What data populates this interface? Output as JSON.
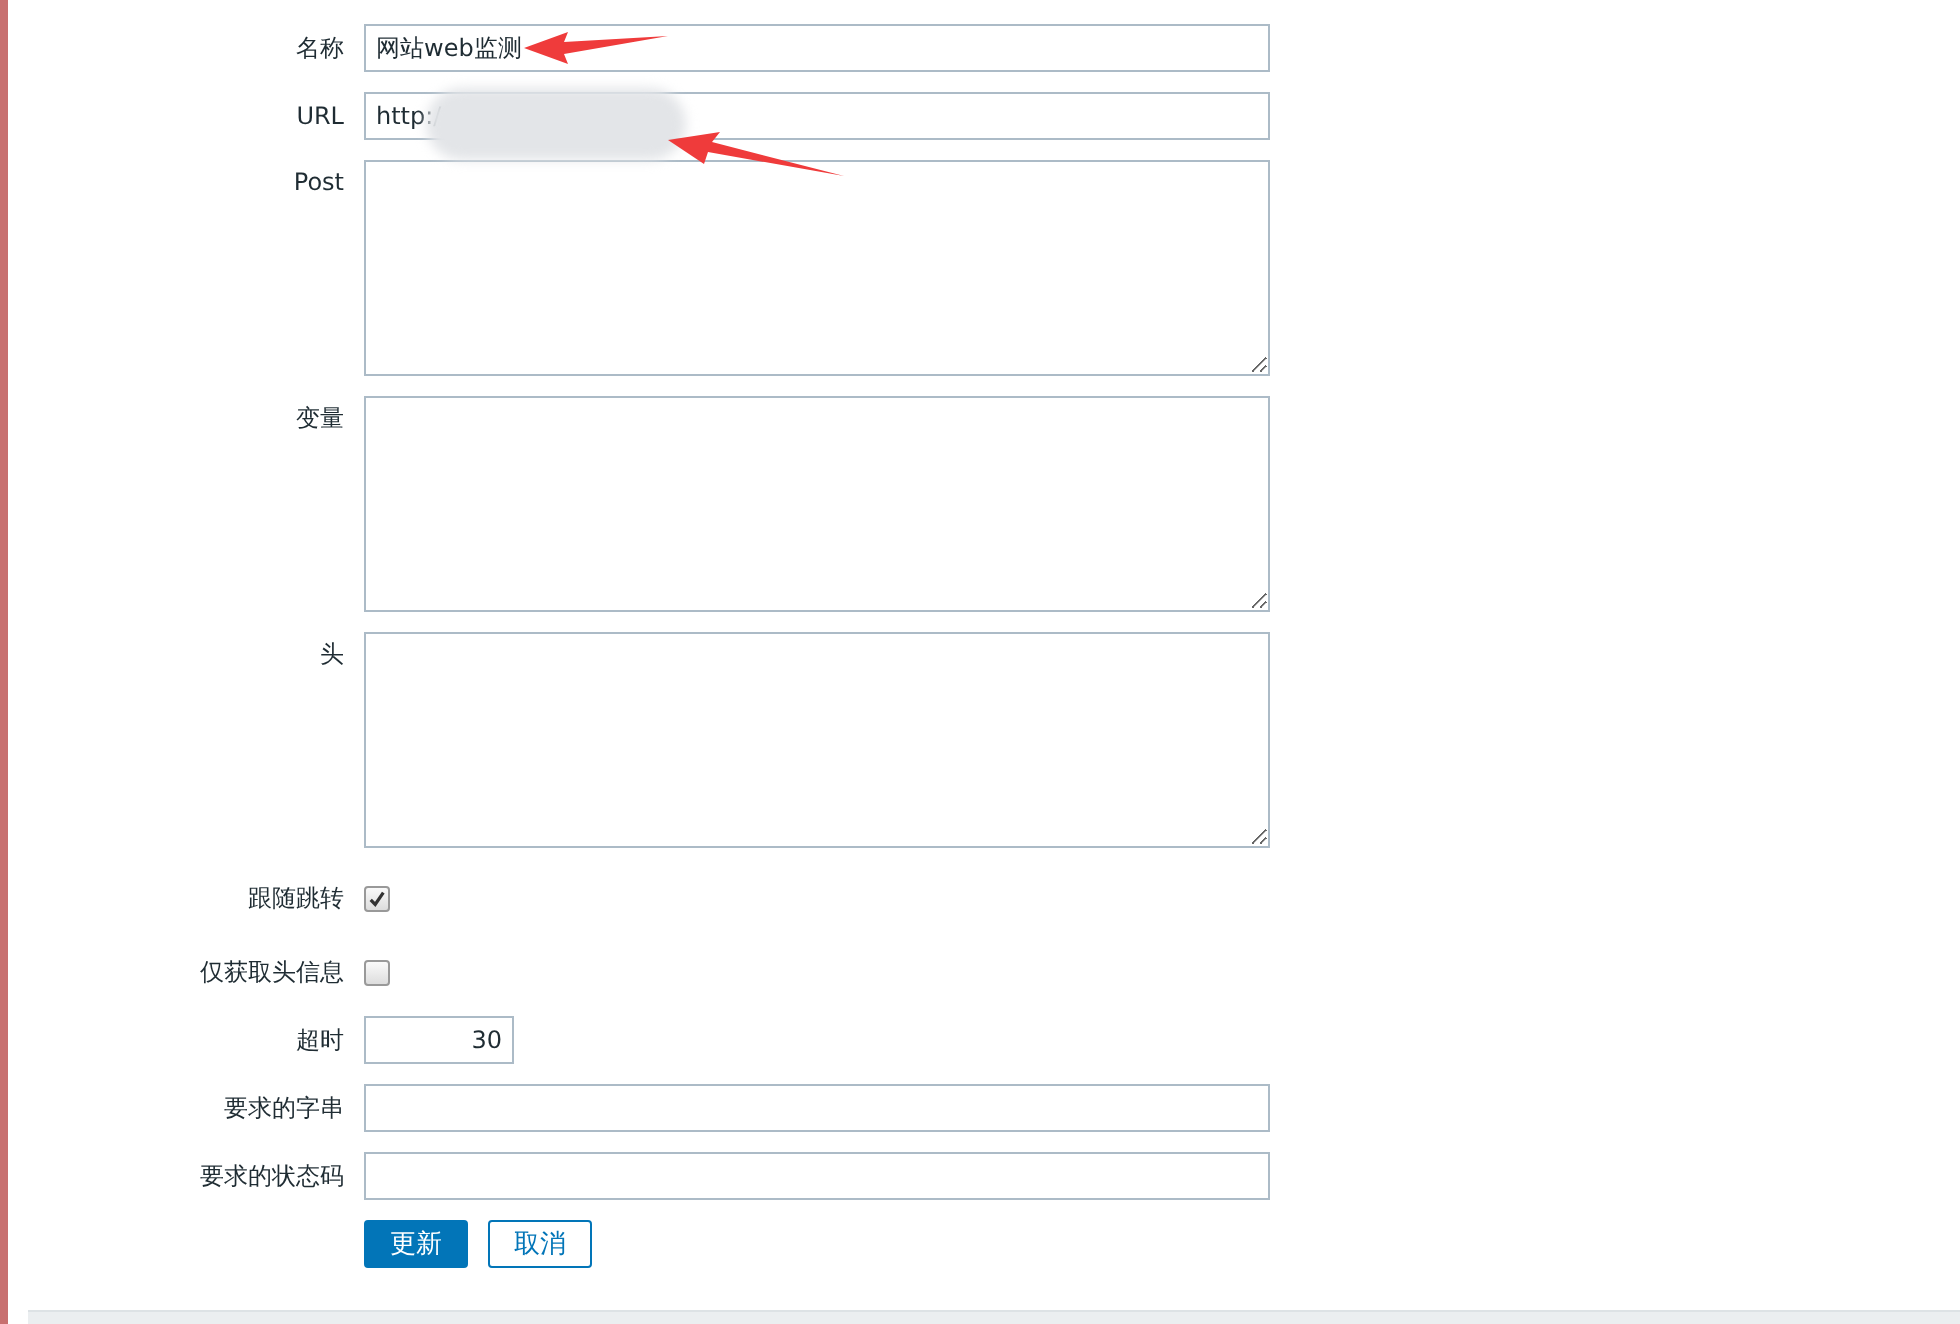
{
  "form": {
    "fields": [
      {
        "kind": "text",
        "label": "名称",
        "value": "网站web监测"
      },
      {
        "kind": "text",
        "label": "URL",
        "value": "http:/"
      },
      {
        "kind": "textarea",
        "label": "Post"
      },
      {
        "kind": "textarea",
        "label": "变量"
      },
      {
        "kind": "textarea",
        "label": "头"
      },
      {
        "kind": "checkbox",
        "label": "跟随跳转",
        "checked": true
      },
      {
        "kind": "checkbox",
        "label": "仅获取头信息",
        "checked": false
      },
      {
        "kind": "number",
        "label": "超时",
        "value": "30"
      },
      {
        "kind": "text",
        "label": "要求的字串"
      },
      {
        "kind": "text",
        "label": "要求的状态码"
      }
    ],
    "buttons": [
      {
        "label": "更新",
        "primary": true
      },
      {
        "label": "取消",
        "primary": false
      }
    ]
  }
}
